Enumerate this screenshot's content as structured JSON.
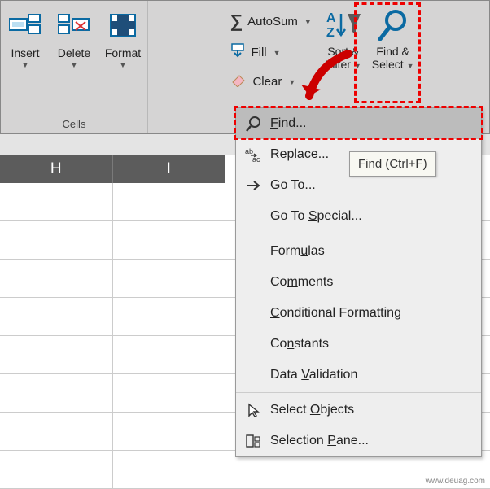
{
  "ribbon": {
    "cells": {
      "insert": "Insert",
      "delete": "Delete",
      "format": "Format",
      "group_label": "Cells"
    },
    "editing": {
      "autosum": "AutoSum",
      "fill": "Fill",
      "clear": "Clear",
      "sort_filter_l1": "Sort &",
      "sort_filter_l2": "Filter",
      "find_select_l1": "Find &",
      "find_select_l2": "Select"
    }
  },
  "columns": {
    "h": "H",
    "i": "I"
  },
  "dropdown": {
    "find": "Find...",
    "replace": "Replace...",
    "goto": "Go To...",
    "gotospecial": "Go To Special...",
    "formulas": "Formulas",
    "comments": "Comments",
    "conditional": "Conditional Formatting",
    "constants": "Constants",
    "datavalidation": "Data Validation",
    "selectobjects": "Select Objects",
    "selectionpane": "Selection Pane..."
  },
  "tooltip": "Find (Ctrl+F)",
  "watermark": "www.deuag.com"
}
